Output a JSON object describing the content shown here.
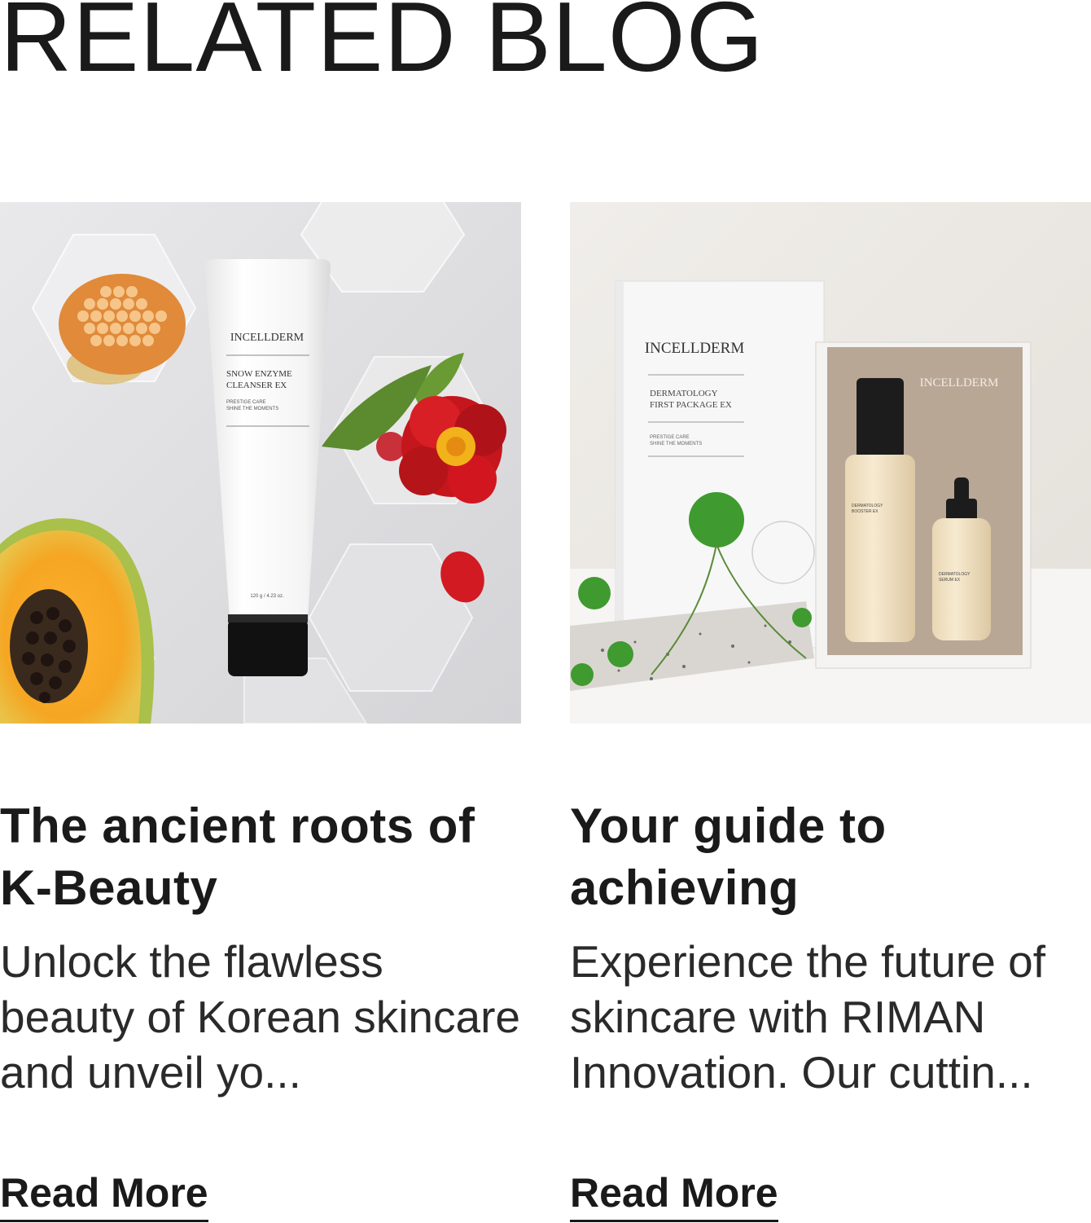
{
  "section": {
    "title": "RELATED BLOG"
  },
  "posts": [
    {
      "title": "The ancient roots of K-Beauty",
      "excerpt": "Unlock the flawless beauty of Korean skincare and unveil yo...",
      "link_label": "Read More",
      "image": {
        "brand": "INCELLDERM",
        "product_line1": "SNOW ENZYME",
        "product_line2": "CLEANSER EX",
        "tagline1": "PRESTIGE CARE",
        "tagline2": "SHINE THE MOMENTS",
        "size": "120 g / 4.23 oz."
      }
    },
    {
      "title": "Your guide to achieving",
      "excerpt": "Experience the future of skincare with RIMAN Innovation. Our cuttin...",
      "link_label": "Read More",
      "image": {
        "brand": "INCELLDERM",
        "box_line1": "DERMATOLOGY",
        "box_line2": "FIRST PACKAGE EX",
        "tagline1": "PRESTIGE CARE",
        "tagline2": "SHINE THE MOMENTS",
        "inner_brand": "INCELLDERM",
        "bottle1_line1": "DERMATOLOGY",
        "bottle1_line2": "BOOSTER EX",
        "bottle2_line1": "DERMATOLOGY",
        "bottle2_line2": "SERUM EX"
      }
    }
  ],
  "colors": {
    "text": "#1a1a1a",
    "background": "#ffffff"
  }
}
